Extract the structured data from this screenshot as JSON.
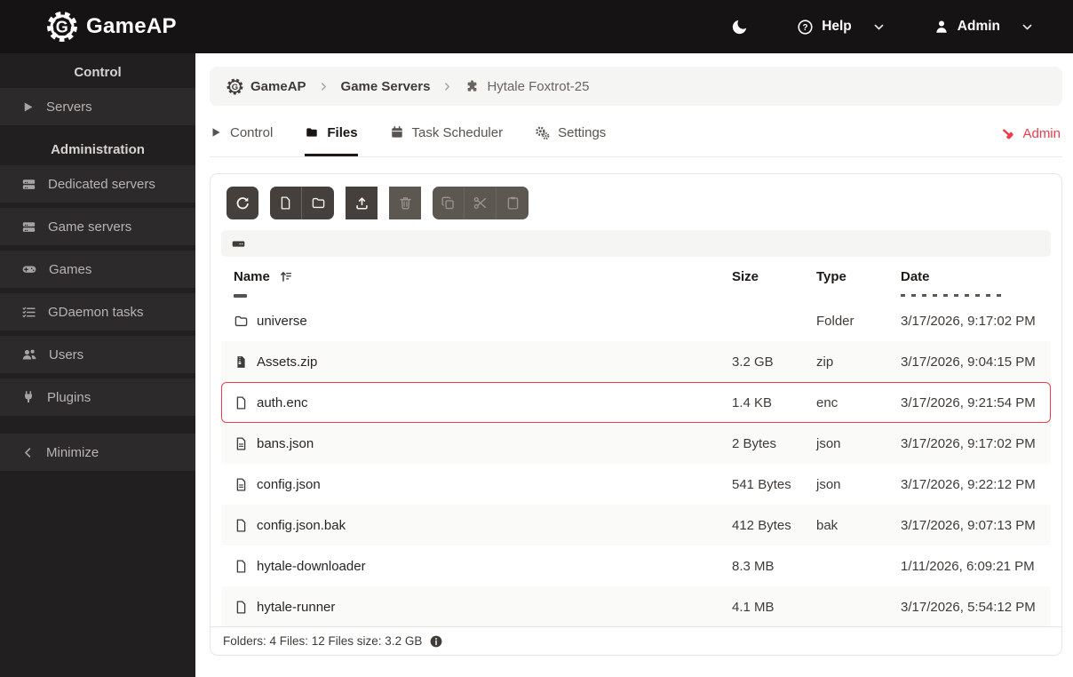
{
  "colors": {
    "accent_red": "#ee3b4d",
    "topbar_bg": "#151313",
    "sidebar_bg": "#211f1f",
    "sidebar_item_bg": "#2c2a2a",
    "toolbar_button_bg": "#45403b"
  },
  "topbar": {
    "brand": "GameAP",
    "theme_icon": "moon-icon",
    "help_label": "Help",
    "user_label": "Admin"
  },
  "sidebar": {
    "sections": [
      {
        "header": "Control",
        "items": [
          {
            "icon": "play-icon",
            "label": "Servers"
          }
        ]
      },
      {
        "header": "Administration",
        "items": [
          {
            "icon": "server-icon",
            "label": "Dedicated servers"
          },
          {
            "icon": "server-icon",
            "label": "Game servers"
          },
          {
            "icon": "gamepad-icon",
            "label": "Games"
          },
          {
            "icon": "task-list-icon",
            "label": "GDaemon tasks"
          },
          {
            "icon": "users-icon",
            "label": "Users"
          },
          {
            "icon": "plug-icon",
            "label": "Plugins"
          }
        ]
      }
    ],
    "minimize_label": "Minimize"
  },
  "breadcrumb": {
    "items": [
      {
        "icon": "gameap-gear-icon",
        "label": "GameAP"
      },
      {
        "icon": null,
        "label": "Game Servers"
      },
      {
        "icon": "puzzle-icon",
        "label": "Hytale Foxtrot-25"
      }
    ]
  },
  "tabs": {
    "items": [
      {
        "icon": "play-icon",
        "label": "Control",
        "active": false
      },
      {
        "icon": "folder-icon",
        "label": "Files",
        "active": true
      },
      {
        "icon": "calendar-icon",
        "label": "Task Scheduler",
        "active": false
      },
      {
        "icon": "gears-icon",
        "label": "Settings",
        "active": false
      }
    ],
    "admin": {
      "icon": "hammer-icon",
      "label": "Admin",
      "color": "#ee3b4d"
    }
  },
  "file_manager": {
    "toolbar": [
      {
        "icon": "refresh-icon",
        "enabled": true
      },
      {
        "icon": "new-file-icon",
        "enabled": true
      },
      {
        "icon": "new-folder-icon",
        "enabled": true
      },
      {
        "icon": "upload-icon",
        "enabled": true
      },
      {
        "icon": "delete-icon",
        "enabled": false
      },
      {
        "icon": "copy-icon",
        "enabled": false
      },
      {
        "icon": "cut-icon",
        "enabled": false
      },
      {
        "icon": "paste-icon",
        "enabled": false
      }
    ],
    "path_root_icon": "hdd-icon",
    "columns": {
      "name": "Name",
      "size": "Size",
      "type": "Type",
      "date": "Date"
    },
    "sort": {
      "column": "Name",
      "direction": "asc"
    },
    "rows": [
      {
        "icon": "folder",
        "name": "universe",
        "size": "",
        "type": "Folder",
        "date": "3/17/2026, 9:17:02 PM",
        "highlighted": false
      },
      {
        "icon": "file-archive",
        "name": "Assets.zip",
        "size": "3.2 GB",
        "type": "zip",
        "date": "3/17/2026, 9:04:15 PM",
        "highlighted": false
      },
      {
        "icon": "file",
        "name": "auth.enc",
        "size": "1.4 KB",
        "type": "enc",
        "date": "3/17/2026, 9:21:54 PM",
        "highlighted": true
      },
      {
        "icon": "file-text",
        "name": "bans.json",
        "size": "2 Bytes",
        "type": "json",
        "date": "3/17/2026, 9:17:02 PM",
        "highlighted": false
      },
      {
        "icon": "file-text",
        "name": "config.json",
        "size": "541 Bytes",
        "type": "json",
        "date": "3/17/2026, 9:22:12 PM",
        "highlighted": false
      },
      {
        "icon": "file",
        "name": "config.json.bak",
        "size": "412 Bytes",
        "type": "bak",
        "date": "3/17/2026, 9:07:13 PM",
        "highlighted": false
      },
      {
        "icon": "file",
        "name": "hytale-downloader",
        "size": "8.3 MB",
        "type": "",
        "date": "1/11/2026, 6:09:21 PM",
        "highlighted": false
      },
      {
        "icon": "file",
        "name": "hytale-runner",
        "size": "4.1 MB",
        "type": "",
        "date": "3/17/2026, 5:54:12 PM",
        "highlighted": false
      }
    ],
    "footer": {
      "summary": "Folders: 4 Files: 12 Files size: 3.2 GB",
      "info_icon": "info-icon"
    },
    "highlight_color": "#ee3b4d"
  }
}
